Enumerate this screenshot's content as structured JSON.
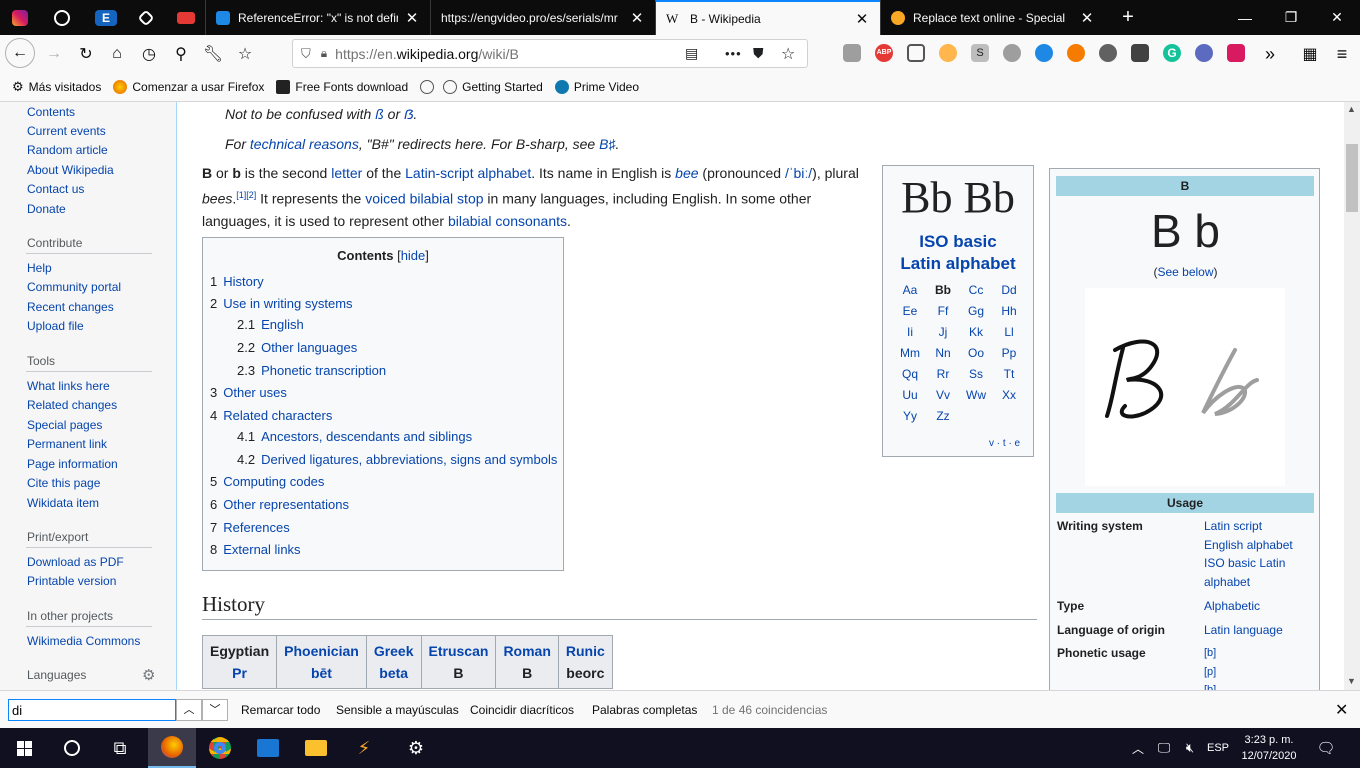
{
  "tabs": {
    "pinned": [
      "instagram",
      "globe",
      "engvideo-e",
      "codepen",
      "youtube"
    ],
    "items": [
      {
        "title": "ReferenceError: \"x\" is not defined",
        "active": false
      },
      {
        "title": "https://engvideo.pro/es/serials/mr",
        "active": false
      },
      {
        "title": "B - Wikipedia",
        "active": true
      },
      {
        "title": "Replace text online - Special",
        "active": false
      }
    ],
    "new_tab": "+"
  },
  "window": {
    "minimize": "—",
    "maximize": "❐",
    "close": "✕"
  },
  "navbar": {
    "url_prefix": "https://en.",
    "url_domain": "wikipedia.org",
    "url_path": "/wiki/B",
    "more": "•••"
  },
  "bookmarks": [
    "Más visitados",
    "Comenzar a usar Firefox",
    "Free Fonts download",
    "",
    "Getting Started",
    "Prime Video"
  ],
  "sidebar": {
    "main": [
      "Contents",
      "Current events",
      "Random article",
      "About Wikipedia",
      "Contact us",
      "Donate"
    ],
    "contribute_heading": "Contribute",
    "contribute": [
      "Help",
      "Community portal",
      "Recent changes",
      "Upload file"
    ],
    "tools_heading": "Tools",
    "tools": [
      "What links here",
      "Related changes",
      "Special pages",
      "Permanent link",
      "Page information",
      "Cite this page",
      "Wikidata item"
    ],
    "print_heading": "Print/export",
    "print": [
      "Download as PDF",
      "Printable version"
    ],
    "projects_heading": "In other projects",
    "projects": [
      "Wikimedia Commons"
    ],
    "languages_heading": "Languages"
  },
  "article": {
    "hatnote1": {
      "pre": "Not to be confused with ",
      "a": "ß",
      "mid": " or ",
      "b": "ẞ",
      "post": "."
    },
    "hatnote2": {
      "pre": "For ",
      "link": "technical reasons",
      "mid": ", \"B#\" redirects here. For B-sharp, see ",
      "link2": "B♯",
      "post": "."
    },
    "intro": {
      "b1": "B",
      "t1": " or ",
      "b2": "b",
      "t2": " is the second ",
      "l1": "letter",
      "t3": " of the ",
      "l2": "Latin-script alphabet",
      "t4": ". Its name in English is ",
      "l3": "bee",
      "t5": " (pronounced ",
      "l4": "/ˈbiː/",
      "t6": "), plural ",
      "i1": "bees",
      "t7": ".",
      "sup": "[1][2]",
      "t8": " It represents the ",
      "l5": "voiced bilabial stop",
      "t9": " in many languages, including English. In some other languages, it is used to represent other ",
      "l6": "bilabial consonants",
      "t10": "."
    },
    "toc": {
      "title": "Contents",
      "hide": "hide",
      "items": [
        {
          "num": "1",
          "label": "History"
        },
        {
          "num": "2",
          "label": "Use in writing systems"
        },
        {
          "num": "2.1",
          "label": "English"
        },
        {
          "num": "2.2",
          "label": "Other languages"
        },
        {
          "num": "2.3",
          "label": "Phonetic transcription"
        },
        {
          "num": "3",
          "label": "Other uses"
        },
        {
          "num": "4",
          "label": "Related characters"
        },
        {
          "num": "4.1",
          "label": "Ancestors, descendants and siblings"
        },
        {
          "num": "4.2",
          "label": "Derived ligatures, abbreviations, signs and symbols"
        },
        {
          "num": "5",
          "label": "Computing codes"
        },
        {
          "num": "6",
          "label": "Other representations"
        },
        {
          "num": "7",
          "label": "References"
        },
        {
          "num": "8",
          "label": "External links"
        }
      ]
    },
    "history_heading": "History",
    "history_table": [
      {
        "h": "Egyptian",
        "s": "Pr"
      },
      {
        "h": "Phoenician",
        "s": "bēt"
      },
      {
        "h": "Greek",
        "s": "beta"
      },
      {
        "h": "Etruscan",
        "s": "B"
      },
      {
        "h": "Roman",
        "s": "B"
      },
      {
        "h": "Runic",
        "s": "beorc"
      }
    ]
  },
  "navbox": {
    "big": "Bb Bb",
    "title1": "ISO basic",
    "title2": "Latin alphabet",
    "letters": [
      "Aa",
      "Bb",
      "Cc",
      "Dd",
      "Ee",
      "Ff",
      "Gg",
      "Hh",
      "Ii",
      "Jj",
      "Kk",
      "Ll",
      "Mm",
      "Nn",
      "Oo",
      "Pp",
      "Qq",
      "Rr",
      "Ss",
      "Tt",
      "Uu",
      "Vv",
      "Ww",
      "Xx",
      "Yy",
      "Zz"
    ],
    "vte": "v · t · e"
  },
  "infobox": {
    "header": "B",
    "glyphs": "B b",
    "see_below_pre": "(",
    "see_below": "See below",
    "see_below_post": ")",
    "usage_header": "Usage",
    "rows": [
      {
        "label": "Writing system",
        "values": [
          "Latin script",
          "English alphabet",
          "ISO basic Latin",
          "alphabet"
        ]
      },
      {
        "label": "Type",
        "values": [
          "Alphabetic"
        ]
      },
      {
        "label": "Language of origin",
        "values": [
          "Latin language"
        ]
      },
      {
        "label": "Phonetic usage",
        "values": [
          "[b]",
          "[p]",
          "[b]"
        ]
      }
    ]
  },
  "findbar": {
    "query": "di",
    "highlight_all": "Remarcar todo",
    "match_case": "Sensible a mayúsculas",
    "diacritics": "Coincidir diacríticos",
    "whole_words": "Palabras completas",
    "status": "1 de 46 coincidencias"
  },
  "taskbar": {
    "lang": "ESP",
    "time": "3:23 p. m.",
    "date": "12/07/2020"
  }
}
